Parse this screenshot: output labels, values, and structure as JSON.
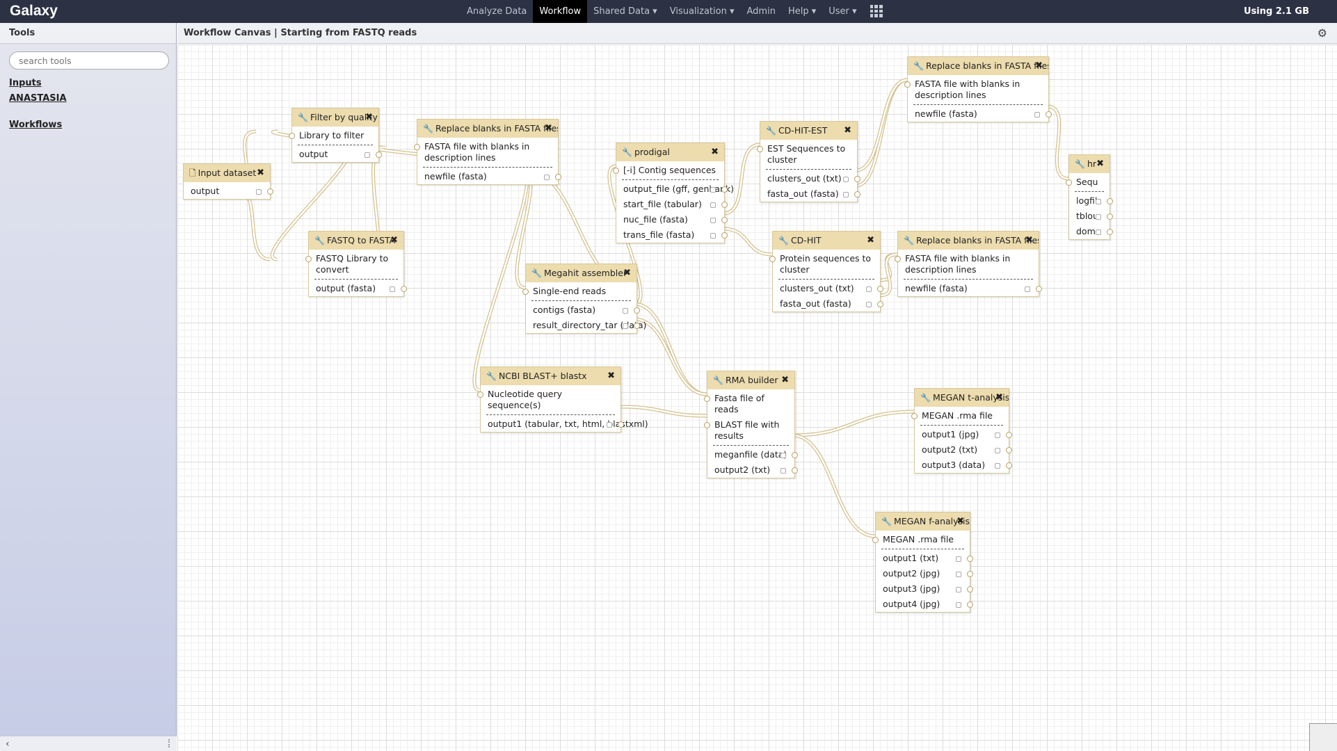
{
  "masthead": {
    "brand": "Galaxy",
    "nav": [
      {
        "label": "Analyze Data",
        "active": false
      },
      {
        "label": "Workflow",
        "active": true
      },
      {
        "label": "Shared Data ▾",
        "active": false
      },
      {
        "label": "Visualization ▾",
        "active": false
      },
      {
        "label": "Admin",
        "active": false
      },
      {
        "label": "Help ▾",
        "active": false
      },
      {
        "label": "User ▾",
        "active": false
      }
    ],
    "apps_icon": "grid-icon",
    "quota": "Using 2.1 GB"
  },
  "left_panel": {
    "title": "Tools",
    "search_placeholder": "search tools",
    "links": [
      "Inputs",
      "ANASTASIA",
      "Workflows"
    ]
  },
  "center": {
    "title": "Workflow Canvas | Starting from FASTQ reads",
    "gear_icon": "⚙"
  },
  "nodes": [
    {
      "title": "Input dataset",
      "icon": "file-icon",
      "inputs": [],
      "outputs": [
        "output"
      ]
    },
    {
      "title": "Filter by quality",
      "icon": "wrench-icon",
      "inputs": [
        "Library to filter"
      ],
      "outputs": [
        "output"
      ]
    },
    {
      "title": "FASTQ to FASTA",
      "icon": "wrench-icon",
      "inputs": [
        "FASTQ Library to convert"
      ],
      "outputs": [
        "output (fasta)"
      ]
    },
    {
      "title": "Replace blanks in FASTA files",
      "icon": "wrench-icon",
      "inputs": [
        "FASTA file with blanks in description lines"
      ],
      "outputs": [
        "newfile (fasta)"
      ]
    },
    {
      "title": "Megahit assembler",
      "icon": "wrench-icon",
      "inputs": [
        "Single-end reads"
      ],
      "outputs": [
        "contigs (fasta)",
        "result_directory_tar (data)"
      ]
    },
    {
      "title": "NCBI BLAST+ blastx",
      "icon": "wrench-icon",
      "inputs": [
        "Nucleotide query sequence(s)"
      ],
      "outputs": [
        "output1 (tabular, txt, html, blastxml)"
      ]
    },
    {
      "title": "prodigal",
      "icon": "wrench-icon",
      "inputs": [
        "[-i] Contig sequences"
      ],
      "outputs": [
        "output_file (gff, genbank)",
        "start_file (tabular)",
        "nuc_file (fasta)",
        "trans_file (fasta)"
      ]
    },
    {
      "title": "CD-HIT-EST",
      "icon": "wrench-icon",
      "inputs": [
        "EST Sequences to cluster"
      ],
      "outputs": [
        "clusters_out (txt)",
        "fasta_out (fasta)"
      ]
    },
    {
      "title": "CD-HIT",
      "icon": "wrench-icon",
      "inputs": [
        "Protein sequences to cluster"
      ],
      "outputs": [
        "clusters_out (txt)",
        "fasta_out (fasta)"
      ]
    },
    {
      "title": "Replace blanks in FASTA files",
      "icon": "wrench-icon",
      "inputs": [
        "FASTA file with blanks in description lines"
      ],
      "outputs": [
        "newfile (fasta)"
      ]
    },
    {
      "title": "Replace blanks in FASTA files",
      "icon": "wrench-icon",
      "inputs": [
        "FASTA file with blanks in description lines"
      ],
      "outputs": [
        "newfile (fasta)"
      ]
    },
    {
      "title": "RMA builder",
      "icon": "wrench-icon",
      "inputs": [
        "Fasta file of reads",
        "BLAST file with results"
      ],
      "outputs": [
        "meganfile (data)",
        "output2 (txt)"
      ]
    },
    {
      "title": "MEGAN t-analysis",
      "icon": "wrench-icon",
      "inputs": [
        "MEGAN .rma file"
      ],
      "outputs": [
        "output1 (jpg)",
        "output2 (txt)",
        "output3 (data)"
      ]
    },
    {
      "title": "MEGAN f-analysis",
      "icon": "wrench-icon",
      "inputs": [
        "MEGAN .rma file"
      ],
      "outputs": [
        "output1 (txt)",
        "output2 (jpg)",
        "output3 (jpg)",
        "output4 (jpg)"
      ]
    },
    {
      "title": "hr",
      "icon": "wrench-icon",
      "inputs": [
        "Sequ"
      ],
      "outputs": [
        "logfil",
        "tblou",
        "dom"
      ]
    }
  ]
}
